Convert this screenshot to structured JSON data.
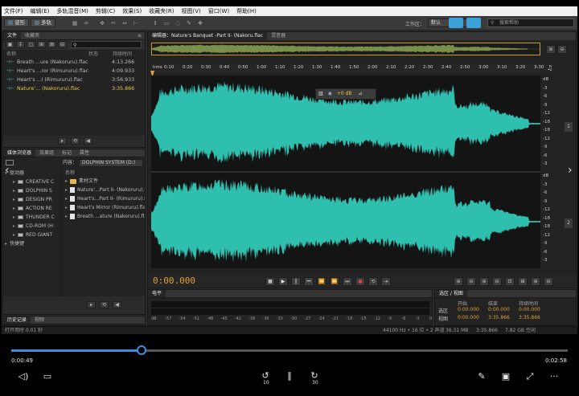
{
  "menu": [
    "文件(F)",
    "编辑(E)",
    "多轨混音(M)",
    "剪辑(C)",
    "效果(S)",
    "收藏夹(R)",
    "视图(V)",
    "窗口(W)",
    "帮助(H)"
  ],
  "toolbar": {
    "mode_wave": "波形",
    "mode_multi": "多轨",
    "workspace_label": "工作区：",
    "workspace_value": "默认",
    "search_placeholder": "搜索帮助"
  },
  "files_panel": {
    "tabs": [
      "文件",
      "收藏夹"
    ],
    "columns": {
      "name": "名称",
      "status": "状态",
      "duration": "持续时间"
    },
    "rows": [
      {
        "name": "Breath ...ure (Nakoruru).flac",
        "duration": "4:13.266"
      },
      {
        "name": "Heart's ...ror (Rimururu).flac",
        "duration": "4:09.933"
      },
      {
        "name": "Heart's ...I (Rimururu).flac",
        "duration": "3:56.933"
      },
      {
        "name": "Nature'... (Nakoruru).flac",
        "duration": "3:35.866"
      }
    ]
  },
  "browser_panel": {
    "tabs": [
      "媒体浏览器",
      "效果组",
      "标记",
      "属性"
    ],
    "content_label": "内容：",
    "content_value": "DOLPHIN SYSTEM (D:)",
    "tree": [
      "驱动器",
      "CREATIVE C",
      "DOLPHIN S",
      "DESIGN PR",
      "ACTION RE",
      "THUNDER C",
      "CD-ROM (H:",
      "RED GIANT",
      "快捷键"
    ],
    "list_header": "名称",
    "list": [
      "素材文件",
      "Nature'...Part II- (Nakoruru).fl",
      "Heart's...Part II- (Rimururu).fl",
      "Heart's Mirror (Rimururu).flac",
      "Breath ...ature (Nakoruru).flac"
    ]
  },
  "editor": {
    "tab": "编辑器：Nature's Banquet -Part II- (Nakoru.flac",
    "tab2": "混音器",
    "ruler_start": "hms",
    "ruler": [
      "0:10",
      "0:20",
      "0:30",
      "0:40",
      "0:50",
      "1:00",
      "1:10",
      "1:20",
      "1:30",
      "1:40",
      "1:50",
      "2:00",
      "2:10",
      "2:20",
      "2:30",
      "2:40",
      "2:50",
      "3:00",
      "3:10",
      "3:20",
      "3:30"
    ],
    "hud_gain": "+0 dB",
    "db_top": [
      "dB",
      "-3",
      "-6",
      "-9",
      "-12",
      "-18",
      "-18",
      "-12",
      "-9",
      "-6",
      "-3"
    ],
    "db_bottom": [
      "dB",
      "-3",
      "-6",
      "-9",
      "-12",
      "-18",
      "-18",
      "-12",
      "-9",
      "-6",
      "-3"
    ],
    "ch1": "1",
    "ch2": "2",
    "time": "0:00.000",
    "wave_color": "#2fbfae"
  },
  "level_panel": {
    "tab": "电平",
    "scale": [
      "dB",
      "-57",
      "-54",
      "-51",
      "-48",
      "-45",
      "-42",
      "-39",
      "-36",
      "-33",
      "-30",
      "-27",
      "-24",
      "-21",
      "-18",
      "-15",
      "-12",
      "-9",
      "-6",
      "-3",
      "0"
    ]
  },
  "selection_panel": {
    "tab": "选区 / 视图",
    "headers": [
      "开始",
      "结束",
      "持续时间"
    ],
    "rows": [
      {
        "label": "选区",
        "start": "0:00.000",
        "end": "0:00.000",
        "dur": "0:00.000"
      },
      {
        "label": "视图",
        "start": "0:00.000",
        "end": "3:35.866",
        "dur": "3:35.866"
      }
    ]
  },
  "history_panel": {
    "tabs": [
      "历史记录",
      "视频"
    ]
  },
  "status": {
    "left": "打开用时 0.01 秒",
    "info": "44100 Hz • 16 位 • 2 声道",
    "size": "36.31 MB",
    "dur": "3:35.866",
    "free": "7.82 GB 空闲"
  },
  "player": {
    "current": "0:00:49",
    "total": "0:02:58",
    "progress": 0.234,
    "skip_back": "10",
    "skip_fwd": "30"
  }
}
